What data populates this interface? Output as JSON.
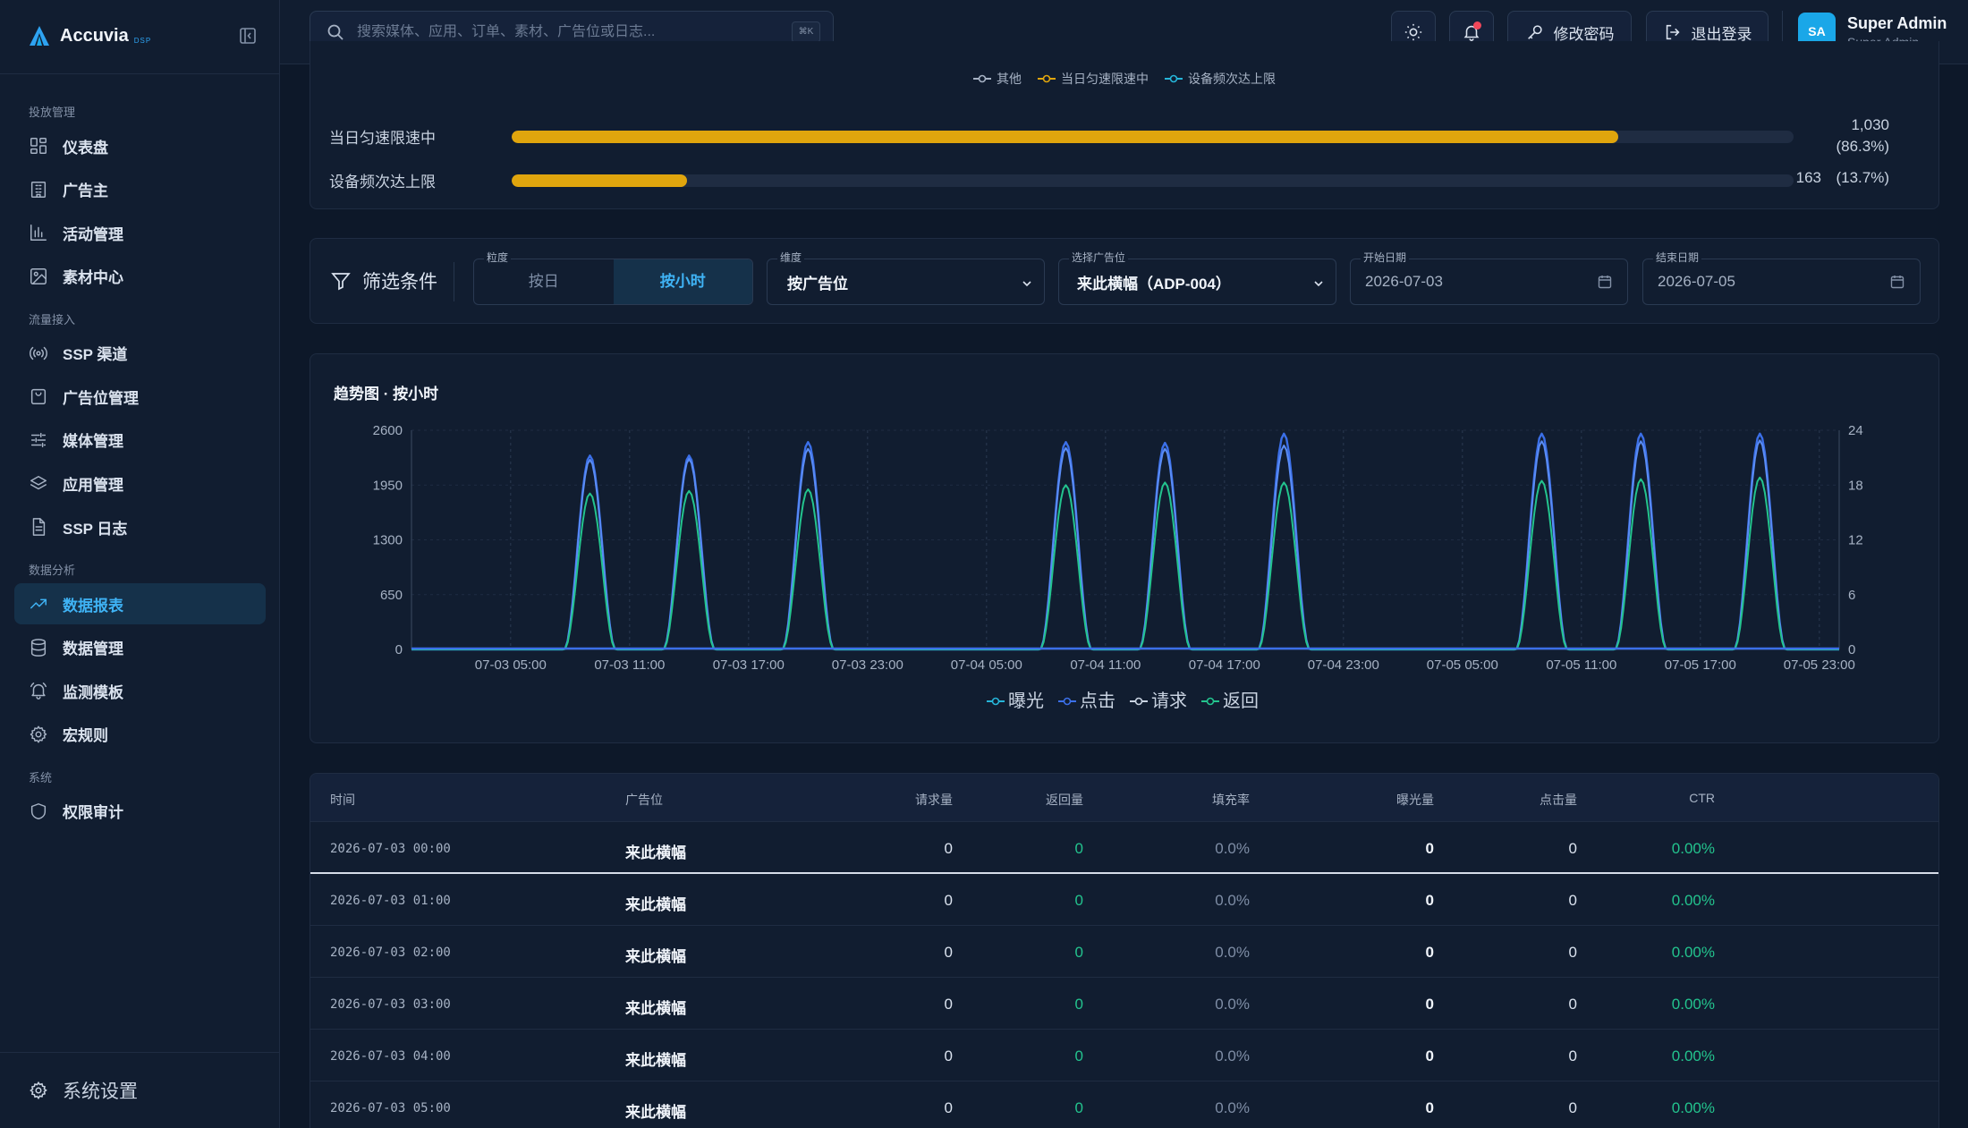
{
  "brand": {
    "name": "Accuvia",
    "tag": "DSP"
  },
  "sidebar": {
    "sections": [
      {
        "title": "投放管理",
        "items": [
          {
            "label": "仪表盘",
            "icon": "dashboard-icon"
          },
          {
            "label": "广告主",
            "icon": "building-icon"
          },
          {
            "label": "活动管理",
            "icon": "bar-chart-icon"
          },
          {
            "label": "素材中心",
            "icon": "image-icon"
          }
        ]
      },
      {
        "title": "流量接入",
        "items": [
          {
            "label": "SSP 渠道",
            "icon": "broadcast-icon"
          },
          {
            "label": "广告位管理",
            "icon": "bag-icon"
          },
          {
            "label": "媒体管理",
            "icon": "sliders-icon"
          },
          {
            "label": "应用管理",
            "icon": "layers-icon"
          },
          {
            "label": "SSP 日志",
            "icon": "file-icon"
          }
        ]
      },
      {
        "title": "数据分析",
        "items": [
          {
            "label": "数据报表",
            "icon": "trend-icon",
            "active": true
          },
          {
            "label": "数据管理",
            "icon": "database-icon"
          },
          {
            "label": "监测模板",
            "icon": "bell-ring-icon"
          },
          {
            "label": "宏规则",
            "icon": "gear-icon"
          }
        ]
      },
      {
        "title": "系统",
        "items": [
          {
            "label": "权限审计",
            "icon": "shield-icon"
          }
        ]
      }
    ],
    "settings_label": "系统设置"
  },
  "topbar": {
    "search_placeholder": "搜索媒体、应用、订单、素材、广告位或日志...",
    "search_shortcut": "⌘K",
    "change_password": "修改密码",
    "logout": "退出登录",
    "user": {
      "initials": "SA",
      "name": "Super Admin",
      "role": "Super Admin"
    }
  },
  "reasons": {
    "legend": [
      "其他",
      "当日匀速限速中",
      "设备频次达上限"
    ],
    "legend_colors": [
      "#a6b2c4",
      "#e0a50d",
      "#26b5d9"
    ],
    "bars": [
      {
        "label": "当日匀速限速中",
        "count": "1,030",
        "pct": "(86.3%)",
        "fraction": 0.863
      },
      {
        "label": "设备频次达上限",
        "count": "163",
        "pct": "(13.7%)",
        "fraction": 0.137
      }
    ]
  },
  "filters": {
    "title": "筛选条件",
    "granularity_label": "粒度",
    "granularity_options": [
      "按日",
      "按小时"
    ],
    "granularity_selected": "按小时",
    "dimension_label": "维度",
    "dimension_value": "按广告位",
    "slot_label": "选择广告位",
    "slot_value": "来此横幅（ADP-004）",
    "start_label": "开始日期",
    "start_value": "2026-07-03",
    "end_label": "结束日期",
    "end_value": "2026-07-05"
  },
  "chart_data": {
    "type": "line",
    "title": "趋势图 · 按小时",
    "x_tick_labels": [
      "07-03 05:00",
      "07-03 11:00",
      "07-03 17:00",
      "07-03 23:00",
      "07-04 05:00",
      "07-04 11:00",
      "07-04 17:00",
      "07-04 23:00",
      "07-05 05:00",
      "07-05 11:00",
      "07-05 17:00",
      "07-05 23:00"
    ],
    "y_left_ticks": [
      0,
      650,
      1300,
      1950,
      2600
    ],
    "y_right_ticks": [
      0,
      6,
      12,
      18,
      24
    ],
    "ylim_left": [
      0,
      2600
    ],
    "ylim_right": [
      0,
      24
    ],
    "hours": 72,
    "peaks": [
      {
        "hour": 9,
        "expose": 2300,
        "click": 2250,
        "response": 1850
      },
      {
        "hour": 14,
        "expose": 2300,
        "click": 2260,
        "response": 1880
      },
      {
        "hour": 20,
        "expose": 2460,
        "click": 2380,
        "response": 1900
      },
      {
        "hour": 33,
        "expose": 2460,
        "click": 2390,
        "response": 1950
      },
      {
        "hour": 38,
        "expose": 2450,
        "click": 2380,
        "response": 1980
      },
      {
        "hour": 44,
        "expose": 2560,
        "click": 2420,
        "response": 1980
      },
      {
        "hour": 57,
        "expose": 2560,
        "click": 2470,
        "response": 2000
      },
      {
        "hour": 62,
        "expose": 2560,
        "click": 2470,
        "response": 2020
      },
      {
        "hour": 68,
        "expose": 2560,
        "click": 2480,
        "response": 2040
      }
    ],
    "series": [
      {
        "name": "曝光",
        "color": "#26b5d9"
      },
      {
        "name": "点击",
        "color": "#3b6fe8"
      },
      {
        "name": "请求",
        "color": "#c9d3e1"
      },
      {
        "name": "返回",
        "color": "#23c48e"
      }
    ]
  },
  "table": {
    "headers": [
      "时间",
      "广告位",
      "请求量",
      "返回量",
      "填充率",
      "曝光量",
      "点击量",
      "CTR"
    ],
    "rows": [
      {
        "time": "2026-07-03 00:00",
        "slot": "来此横幅",
        "req": "0",
        "resp": "0",
        "fill": "0.0%",
        "expose": "0",
        "click": "0",
        "ctr": "0.00%"
      },
      {
        "time": "2026-07-03 01:00",
        "slot": "来此横幅",
        "req": "0",
        "resp": "0",
        "fill": "0.0%",
        "expose": "0",
        "click": "0",
        "ctr": "0.00%"
      },
      {
        "time": "2026-07-03 02:00",
        "slot": "来此横幅",
        "req": "0",
        "resp": "0",
        "fill": "0.0%",
        "expose": "0",
        "click": "0",
        "ctr": "0.00%"
      },
      {
        "time": "2026-07-03 03:00",
        "slot": "来此横幅",
        "req": "0",
        "resp": "0",
        "fill": "0.0%",
        "expose": "0",
        "click": "0",
        "ctr": "0.00%"
      },
      {
        "time": "2026-07-03 04:00",
        "slot": "来此横幅",
        "req": "0",
        "resp": "0",
        "fill": "0.0%",
        "expose": "0",
        "click": "0",
        "ctr": "0.00%"
      },
      {
        "time": "2026-07-03 05:00",
        "slot": "来此横幅",
        "req": "0",
        "resp": "0",
        "fill": "0.0%",
        "expose": "0",
        "click": "0",
        "ctr": "0.00%"
      }
    ]
  }
}
